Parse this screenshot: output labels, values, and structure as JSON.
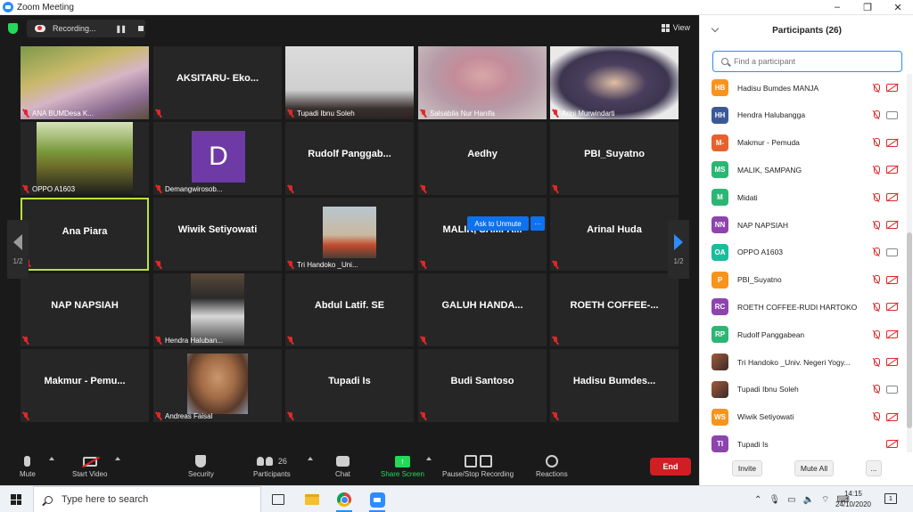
{
  "window": {
    "title": "Zoom Meeting",
    "controls": [
      "–",
      "❐",
      "✕"
    ]
  },
  "topbar": {
    "recording_label": "Recording...",
    "view_label": "View"
  },
  "tiles": [
    {
      "name": "",
      "label": "ANA BUMDesa K...",
      "photo": "ana"
    },
    {
      "name": "AKSITARU- Eko...",
      "label": ""
    },
    {
      "name": "",
      "label": "Tupadi Ibnu Soleh",
      "photo": "tupadi"
    },
    {
      "name": "",
      "label": "Salsabila Nur Hanifa",
      "photo": "salsa"
    },
    {
      "name": "",
      "label": "Arini Murwindarti",
      "photo": "arini"
    },
    {
      "name": "",
      "label": "OPPO A1603",
      "photo": "oppo"
    },
    {
      "name": "",
      "label": "Demangwirosob...",
      "avatar_letter": "D"
    },
    {
      "name": "Rudolf Panggab...",
      "label": ""
    },
    {
      "name": "Aedhy",
      "label": ""
    },
    {
      "name": "PBI_Suyatno",
      "label": ""
    },
    {
      "name": "Ana Piara",
      "label": ""
    },
    {
      "name": "Wiwik Setiyowati",
      "label": ""
    },
    {
      "name": "",
      "label": "Tri Handoko _Uni...",
      "photo": "tri"
    },
    {
      "name": "MALIK, SAMPA...",
      "label": ""
    },
    {
      "name": "Arinal Huda",
      "label": ""
    },
    {
      "name": "NAP NAPSIAH",
      "label": ""
    },
    {
      "name": "",
      "label": "Hendra Haluban...",
      "photo": "hendra"
    },
    {
      "name": "Abdul Latif. SE",
      "label": ""
    },
    {
      "name": "GALUH HANDA...",
      "label": ""
    },
    {
      "name": "ROETH COFFEE-...",
      "label": ""
    },
    {
      "name": "Makmur - Pemu...",
      "label": ""
    },
    {
      "name": "",
      "label": "Andreas Faisal",
      "photo": "andreas"
    },
    {
      "name": "Tupadi Is",
      "label": ""
    },
    {
      "name": "Budi Santoso",
      "label": ""
    },
    {
      "name": "Hadisu Bumdes...",
      "label": ""
    }
  ],
  "ask_unmute": {
    "label": "Ask to Unmute",
    "more": "···"
  },
  "pager": {
    "left": "1/2",
    "right": "1/2"
  },
  "toolbar": {
    "mute": "Mute",
    "start_video": "Start Video",
    "security": "Security",
    "participants": "Participants",
    "participants_count": "26",
    "chat": "Chat",
    "share_screen": "Share Screen",
    "pause_stop_recording": "Pause/Stop Recording",
    "reactions": "Reactions",
    "end": "End"
  },
  "panel": {
    "title": "Participants (26)",
    "search_placeholder": "Find a participant",
    "participants": [
      {
        "initials": "HB",
        "name": "Hadisu Bumdes MANJA",
        "color": "#f7941d",
        "cam": "off"
      },
      {
        "initials": "HH",
        "name": "Hendra Halubangga",
        "color": "#3b5998",
        "cam": "on"
      },
      {
        "initials": "M-",
        "name": "Makmur - Pemuda",
        "color": "#e8612c",
        "cam": "off"
      },
      {
        "initials": "MS",
        "name": "MALIK, SAMPANG",
        "color": "#2bb673",
        "cam": "off"
      },
      {
        "initials": "M",
        "name": "Midati",
        "color": "#2bb673",
        "cam": "off"
      },
      {
        "initials": "NN",
        "name": "NAP NAPSIAH",
        "color": "#8e44ad",
        "cam": "off"
      },
      {
        "initials": "OA",
        "name": "OPPO A1603",
        "color": "#1abc9c",
        "cam": "on"
      },
      {
        "initials": "P",
        "name": "PBI_Suyatno",
        "color": "#f7941d",
        "cam": "off"
      },
      {
        "initials": "RC",
        "name": "ROETH COFFEE-RUDI HARTOKO",
        "color": "#8e44ad",
        "cam": "off"
      },
      {
        "initials": "RP",
        "name": "Rudolf Panggabean",
        "color": "#2bb673",
        "cam": "off"
      },
      {
        "initials": "",
        "name": "Tri Handoko _Univ. Negeri Yogy...",
        "color": "",
        "cam": "off"
      },
      {
        "initials": "",
        "name": "Tupadi Ibnu Soleh",
        "color": "",
        "cam": "on"
      },
      {
        "initials": "WS",
        "name": "Wiwik Setiyowati",
        "color": "#f7941d",
        "cam": "off"
      },
      {
        "initials": "TI",
        "name": "Tupadi Is",
        "color": "#8e44ad",
        "cam": "off"
      }
    ],
    "invite": "Invite",
    "mute_all": "Mute All",
    "more": "..."
  },
  "taskbar": {
    "search_placeholder": "Type here to search",
    "time": "14:15",
    "date": "24/10/2020",
    "notifications": "1"
  }
}
